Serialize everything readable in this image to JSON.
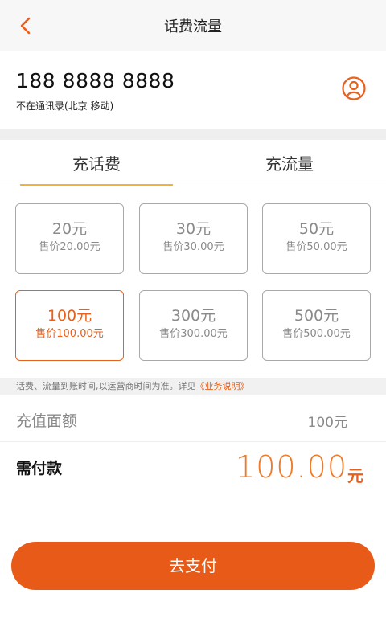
{
  "header": {
    "title": "话费流量",
    "back_icon": "chevron-left-icon"
  },
  "phone": {
    "number": "188 8888 8888",
    "subtitle": "不在通讯录(北京 移动)",
    "contact_icon": "person-circle-icon"
  },
  "tabs": [
    {
      "label": "充话费",
      "active": true
    },
    {
      "label": "充流量",
      "active": false
    }
  ],
  "amounts": [
    {
      "amount": "20元",
      "price": "售价20.00元",
      "selected": false
    },
    {
      "amount": "30元",
      "price": "售价30.00元",
      "selected": false
    },
    {
      "amount": "50元",
      "price": "售价50.00元",
      "selected": false
    },
    {
      "amount": "100元",
      "price": "售价100.00元",
      "selected": true
    },
    {
      "amount": "300元",
      "price": "售价300.00元",
      "selected": false
    },
    {
      "amount": "500元",
      "price": "售价500.00元",
      "selected": false
    }
  ],
  "notice": {
    "text": "话费、流量到账时间,以运营商时间为准。详见",
    "link": "《业务说明》"
  },
  "summary": {
    "face_label": "充值面额",
    "face_value": "100元",
    "pay_label": "需付款",
    "pay_amount": "100.00",
    "pay_unit": "元"
  },
  "button": {
    "label": "去支付"
  },
  "colors": {
    "accent": "#e85a17",
    "tab_indicator": "#f1b33a",
    "border": "#a9a9a9"
  }
}
